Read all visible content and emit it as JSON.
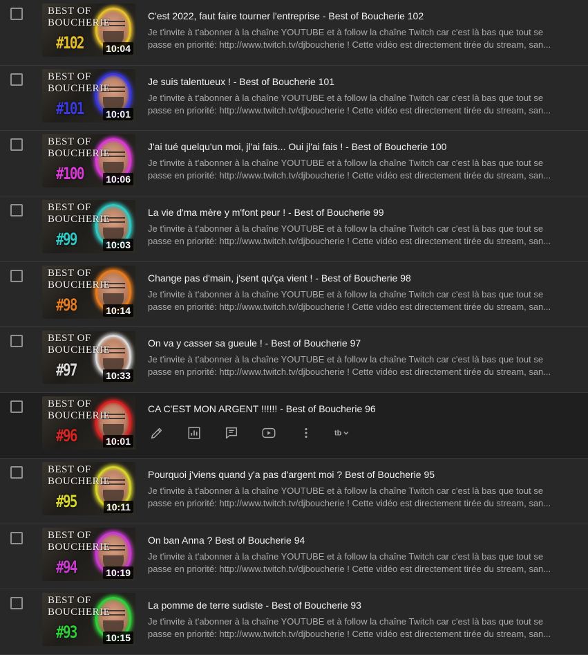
{
  "colors": {
    "background": "#282828",
    "hover_row": "#1f1f1f",
    "title": "#f1f1f1",
    "description": "#aaaaaa"
  },
  "videos": [
    {
      "thumb_line1": "BEST OF",
      "thumb_line2": "BOUCHERIE",
      "thumb_number": "#102",
      "accent": "#e6c02b",
      "duration": "10:04",
      "title": "C'est 2022, faut faire tourner l'entreprise - Best of Boucherie 102",
      "desc_line1": "Je t'invite à t'abonner à la chaîne YOUTUBE et à follow la chaîne Twitch car c'est là bas que tout se",
      "desc_line2": "passe en priorité: http://www.twitch.tv/djboucherie ! Cette vidéo est directement tirée du stream, san..."
    },
    {
      "thumb_line1": "BEST OF",
      "thumb_line2": "BOUCHERIE",
      "thumb_number": "#101",
      "accent": "#3a3ae0",
      "duration": "10:01",
      "title": "Je suis talentueux ! - Best of Boucherie 101",
      "desc_line1": "Je t'invite à t'abonner à la chaîne YOUTUBE et à follow la chaîne Twitch car c'est là bas que tout se",
      "desc_line2": "passe en priorité: http://www.twitch.tv/djboucherie ! Cette vidéo est directement tirée du stream, san..."
    },
    {
      "thumb_line1": "BEST OF",
      "thumb_line2": "BOUCHERIE",
      "thumb_number": "#100",
      "accent": "#d93ad6",
      "duration": "10:06",
      "title": "J'ai tué quelqu'un moi, jl'ai fais... Oui jl'ai fais ! - Best of Boucherie 100",
      "desc_line1": "Je t'invite à t'abonner à la chaîne YOUTUBE et à follow la chaîne Twitch car c'est là bas que tout se",
      "desc_line2": "passe en priorité: http://www.twitch.tv/djboucherie ! Cette vidéo est directement tirée du stream, san..."
    },
    {
      "thumb_line1": "BEST OF",
      "thumb_line2": "BOUCHERIE",
      "thumb_number": "#99",
      "accent": "#2ec9c4",
      "duration": "10:03",
      "title": "La vie d'ma mère y m'font peur ! - Best of Boucherie 99",
      "desc_line1": "Je t'invite à t'abonner à la chaîne YOUTUBE et à follow la chaîne Twitch car c'est là bas que tout se",
      "desc_line2": "passe en priorité: http://www.twitch.tv/djboucherie ! Cette vidéo est directement tirée du stream, san..."
    },
    {
      "thumb_line1": "BEST OF",
      "thumb_line2": "BOUCHERIE",
      "thumb_number": "#98",
      "accent": "#e57b1f",
      "duration": "10:14",
      "title": "Change pas d'main, j'sent qu'ça vient ! - Best of Boucherie 98",
      "desc_line1": "Je t'invite à t'abonner à la chaîne YOUTUBE et à follow la chaîne Twitch car c'est là bas que tout se",
      "desc_line2": "passe en priorité: http://www.twitch.tv/djboucherie ! Cette vidéo est directement tirée du stream, san..."
    },
    {
      "thumb_line1": "BEST OF",
      "thumb_line2": "BOUCHERIE",
      "thumb_number": "#97",
      "accent": "#d8d8d8",
      "duration": "10:33",
      "title": "On va y casser sa gueule ! - Best of Boucherie 97",
      "desc_line1": "Je t'invite à t'abonner à la chaîne YOUTUBE et à follow la chaîne Twitch car c'est là bas que tout se",
      "desc_line2": "passe en priorité: http://www.twitch.tv/djboucherie ! Cette vidéo est directement tirée du stream, san..."
    },
    {
      "thumb_line1": "BEST OF",
      "thumb_line2": "BOUCHERIE",
      "thumb_number": "#96",
      "accent": "#d92424",
      "duration": "10:01",
      "title": "CA C'EST MON ARGENT !!!!!! - Best of Boucherie 96",
      "hover": true,
      "actions": [
        "pencil-icon",
        "analytics-icon",
        "comments-icon",
        "youtube-play-icon",
        "more-vert-icon",
        "tubebuddy-icon"
      ]
    },
    {
      "thumb_line1": "BEST OF",
      "thumb_line2": "BOUCHERIE",
      "thumb_number": "#95",
      "accent": "#d6d62a",
      "duration": "10:11",
      "title": "Pourquoi j'viens quand y'a pas d'argent moi ? Best of Boucherie 95",
      "desc_line1": "Je t'invite à t'abonner à la chaîne YOUTUBE et à follow la chaîne Twitch car c'est là bas que tout se",
      "desc_line2": "passe en priorité: http://www.twitch.tv/djboucherie ! Cette vidéo est directement tirée du stream, san..."
    },
    {
      "thumb_line1": "BEST OF",
      "thumb_line2": "BOUCHERIE",
      "thumb_number": "#94",
      "accent": "#c93ad0",
      "duration": "10:19",
      "title": "On ban Anna ? Best of Boucherie 94",
      "desc_line1": "Je t'invite à t'abonner à la chaîne YOUTUBE et à follow la chaîne Twitch car c'est là bas que tout se",
      "desc_line2": "passe en priorité: http://www.twitch.tv/djboucherie ! Cette vidéo est directement tirée du stream, san..."
    },
    {
      "thumb_line1": "BEST OF",
      "thumb_line2": "BOUCHERIE",
      "thumb_number": "#93",
      "accent": "#2fcf3a",
      "duration": "10:15",
      "title": "La pomme de terre sudiste - Best of Boucherie 93",
      "desc_line1": "Je t'invite à t'abonner à la chaîne YOUTUBE et à follow la chaîne Twitch car c'est là bas que tout se",
      "desc_line2": "passe en priorité: http://www.twitch.tv/djboucherie ! Cette vidéo est directement tirée du stream, san..."
    }
  ]
}
